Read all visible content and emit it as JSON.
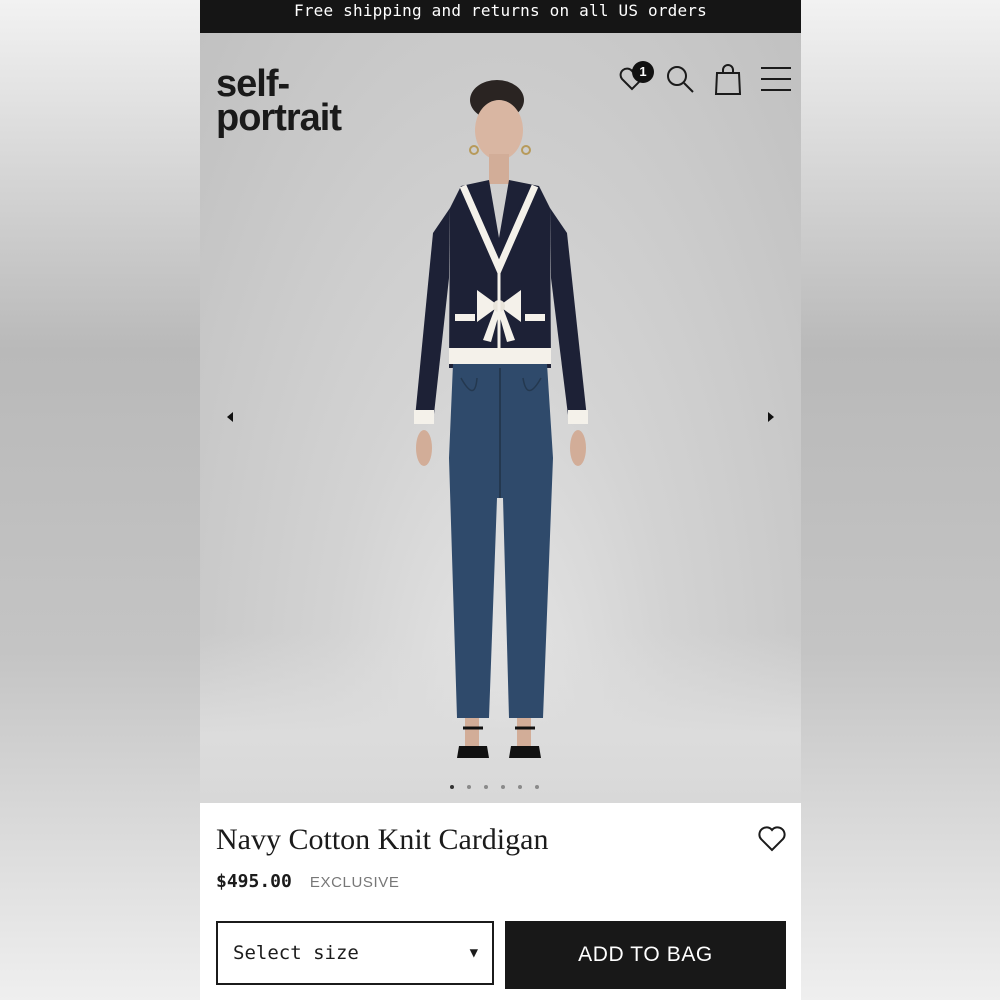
{
  "promo": {
    "text": "Free shipping and returns on all US orders"
  },
  "header": {
    "logo_line1": "self-",
    "logo_line2": "portrait",
    "wishlist_count": "1",
    "icons": [
      "heart-icon",
      "search-icon",
      "bag-icon",
      "menu-icon"
    ]
  },
  "gallery": {
    "slides": 6,
    "active_slide": 1
  },
  "product": {
    "title": "Navy Cotton Knit Cardigan",
    "price": "$495.00",
    "tag": "EXCLUSIVE"
  },
  "actions": {
    "size_placeholder": "Select size",
    "add_to_bag": "ADD TO BAG"
  },
  "colors": {
    "dark": "#181818",
    "navy": "#1d2136",
    "denim": "#2f4a6b"
  }
}
